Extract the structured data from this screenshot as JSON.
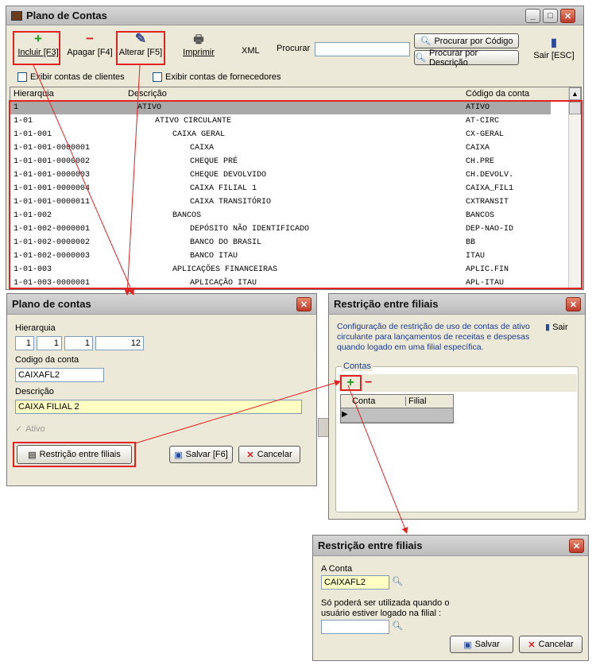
{
  "main": {
    "title": "Plano de Contas",
    "toolbar": {
      "incluir": "Incluir [F3]",
      "apagar": "Apagar [F4]",
      "alterar": "Alterar [F5]",
      "imprimir": "Imprimir",
      "xml": "XML",
      "procurar": "Procurar",
      "procurar_codigo": "Procurar por Código",
      "procurar_descricao": "Procurar por Descrição",
      "sair": "Sair [ESC]"
    },
    "filters": {
      "clientes": "Exibir contas de clientes",
      "fornecedores": "Exibir contas de fornecedores"
    },
    "columns": [
      "Hierarquia",
      "Descrição",
      "Código da conta"
    ],
    "rows": [
      {
        "h": "1",
        "d": "ATIVO",
        "c": "ATIVO"
      },
      {
        "h": "1-01",
        "d": "ATIVO CIRCULANTE",
        "c": "AT-CIRC"
      },
      {
        "h": "1-01-001",
        "d": "CAIXA GERAL",
        "c": "CX-GERAL"
      },
      {
        "h": "1-01-001-0000001",
        "d": "CAIXA",
        "c": "CAIXA"
      },
      {
        "h": "1-01-001-0000002",
        "d": "CHEQUE PRÉ",
        "c": "CH.PRE"
      },
      {
        "h": "1-01-001-0000003",
        "d": "CHEQUE DEVOLVIDO",
        "c": "CH.DEVOLV."
      },
      {
        "h": "1-01-001-0000004",
        "d": "CAIXA FILIAL 1",
        "c": "CAIXA_FIL1"
      },
      {
        "h": "1-01-001-0000011",
        "d": "CAIXA TRANSITÓRIO",
        "c": "CXTRANSIT"
      },
      {
        "h": "1-01-002",
        "d": "BANCOS",
        "c": "BANCOS"
      },
      {
        "h": "1-01-002-0000001",
        "d": "DEPÓSITO NÃO IDENTIFICADO",
        "c": "DEP-NAO-ID"
      },
      {
        "h": "1-01-002-0000002",
        "d": "BANCO DO BRASIL",
        "c": "BB"
      },
      {
        "h": "1-01-002-0000003",
        "d": "BANCO ITAU",
        "c": "ITAU"
      },
      {
        "h": "1-01-003",
        "d": "APLICAÇÕES FINANCEIRAS",
        "c": "APLIC.FIN"
      },
      {
        "h": "1-01-003-0000001",
        "d": "APLICAÇÃO ITAU",
        "c": "APL-ITAU"
      }
    ]
  },
  "plano_dialog": {
    "title": "Plano de contas",
    "hierarquia_label": "Hierarquia",
    "h1": "1",
    "h2": "1",
    "h3": "1",
    "h4": "12",
    "codigo_label": "Codigo da conta",
    "codigo_value": "CAIXAFL2",
    "descricao_label": "Descrição",
    "descricao_value": "CAIXA FILIAL 2",
    "ativo_label": "Ativo",
    "restricao_button": "Restrição entre filiais",
    "salvar_button": "Salvar [F6]",
    "cancelar_button": "Cancelar"
  },
  "restricao_dialog": {
    "title": "Restrição entre filiais",
    "description": "Configuração de restrição de uso de contas de ativo circulante para lançamentos de receitas e despesas quando logado em uma filial específica.",
    "sair": "Sair",
    "group_label": "Contas",
    "col_conta": "Conta",
    "col_filial": "Filial"
  },
  "restricao_small": {
    "title": "Restrição entre filiais",
    "conta_label": "A Conta",
    "conta_value": "CAIXAFL2",
    "info_text": "Só poderá ser utilizada quando o usuário estiver logado na filial :",
    "filial_value": "",
    "salvar_button": "Salvar",
    "cancelar_button": "Cancelar"
  },
  "colors": {
    "accent": "#e32222",
    "selection": "#a9a9a9",
    "field_yellow": "#ffffc4",
    "link_blue": "#1c3b8c"
  }
}
